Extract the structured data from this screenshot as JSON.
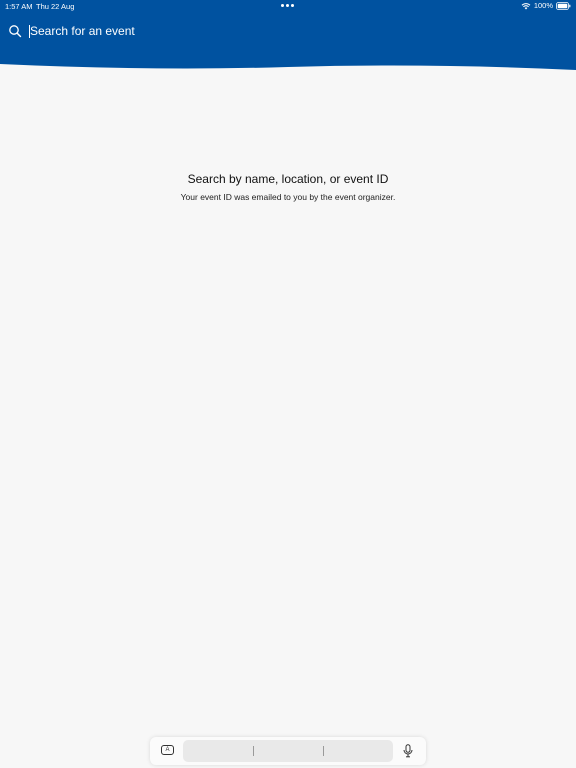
{
  "status_bar": {
    "time": "1:57 AM",
    "date": "Thu 22 Aug",
    "battery": "100%"
  },
  "search": {
    "placeholder": "Search for an event"
  },
  "empty_state": {
    "title": "Search by name, location, or event ID",
    "subtitle": "Your event ID was emailed to you by the event organizer."
  },
  "keyboard_bar": {
    "key_icon_label": "A"
  },
  "colors": {
    "header_blue": "#0052a0",
    "background": "#f7f7f7"
  }
}
